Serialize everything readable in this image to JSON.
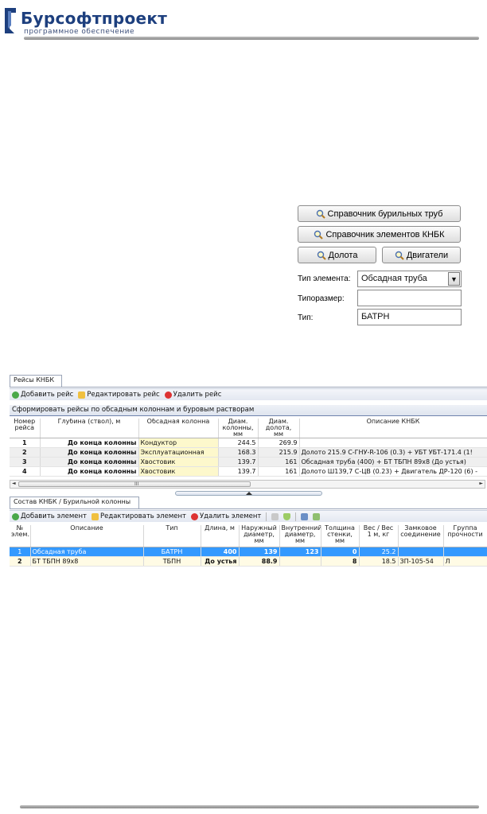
{
  "header": {
    "company_name": "Бурсофтпроект",
    "tagline": "программное обеспечение"
  },
  "reference_buttons": {
    "drill_pipes": "Справочник бурильных труб",
    "bha_elements": "Справочник элементов КНБК",
    "bits": "Долота",
    "motors": "Двигатели"
  },
  "element_form": {
    "type_label": "Тип элемента:",
    "type_value": "Обсадная труба",
    "size_label": "Типоразмер:",
    "size_value": "",
    "kind_label": "Тип:",
    "kind_value": "БАТРН"
  },
  "runs_panel": {
    "tab": "Рейсы КНБК",
    "toolbar": {
      "add": "Добавить рейс",
      "edit": "Редактировать рейс",
      "delete": "Удалить рейс"
    },
    "group_action": "Сформировать рейсы по обсадным колоннам и буровым растворам",
    "columns": [
      "Номер рейса",
      "Глубина (ствол), м",
      "Обсадная колонна",
      "Диам. колонны, мм",
      "Диам. долота, мм",
      "Описание КНБК"
    ],
    "rows": [
      {
        "num": "1",
        "depth": "До конца колонны",
        "casing": "Кондуктор",
        "casing_diam": "244.5",
        "bit_diam": "269.9",
        "description": ""
      },
      {
        "num": "2",
        "depth": "До конца колонны",
        "casing": "Эксплуатационная",
        "casing_diam": "168.3",
        "bit_diam": "215.9",
        "description": "Долото 215.9 С-ГНУ-R-106 (0.3) + УБТ УБТ-171.4 (1!"
      },
      {
        "num": "3",
        "depth": "До конца колонны",
        "casing": "Хвостовик",
        "casing_diam": "139.7",
        "bit_diam": "161",
        "description": "Обсадная труба  (400) + БТ ТБПН 89x8 (До устья)"
      },
      {
        "num": "4",
        "depth": "До конца колонны",
        "casing": "Хвостовик",
        "casing_diam": "139.7",
        "bit_diam": "161",
        "description": "Долото Ш139,7 С-ЦВ (0.23) + Двигатель ДР-120 (6) -"
      }
    ],
    "scroll_grip": "III"
  },
  "composition_panel": {
    "tab": "Состав КНБК / Бурильной колонны",
    "toolbar": {
      "add": "Добавить элемент",
      "edit": "Редактировать элемент",
      "delete": "Удалить элемент"
    },
    "columns": [
      "№ элем.",
      "Описание",
      "Тип",
      "Длина, м",
      "Наружный диаметр, мм",
      "Внутренний диаметр, мм",
      "Толщина стенки, мм",
      "Вес / Вес 1 м, кг",
      "Замковое соединение",
      "Группа прочности"
    ],
    "rows": [
      {
        "num": "1",
        "description": "Обсадная труба",
        "type": "БАТРН",
        "length": "400",
        "od": "139",
        "id": "123",
        "wall": "0",
        "weight": "25.2",
        "joint": "",
        "grade": ""
      },
      {
        "num": "2",
        "description": "БТ ТБПН 89x8",
        "type": "ТБПН",
        "length": "До устья",
        "od": "88.9",
        "id": "",
        "wall": "8",
        "weight": "18.5",
        "joint": "ЗП-105-54",
        "grade": "Л"
      }
    ]
  },
  "colors": {
    "brand_blue": "#1d3f7e",
    "selection": "#3399ff",
    "casing_cell": "#fdf8cc"
  }
}
